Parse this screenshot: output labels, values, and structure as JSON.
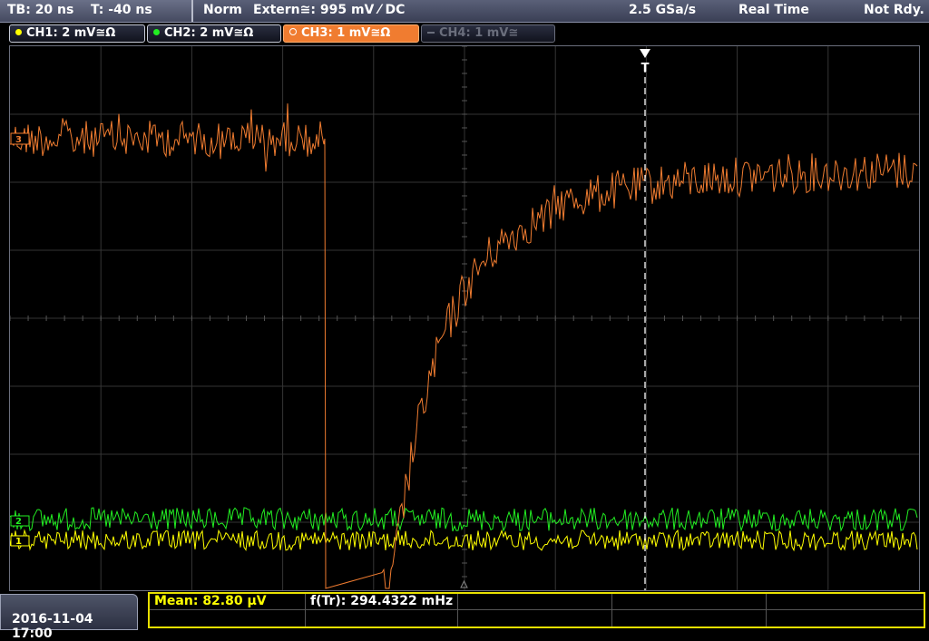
{
  "status_bar": {
    "timebase": "TB: 20 ns",
    "trigger_time": "T: -40 ns",
    "trigger_mode": "Norm",
    "trigger_source": "Extern≅: 995 mV ⁄ DC",
    "sample_rate": "2.5 GSa/s",
    "acquisition_mode": "Real Time",
    "status": "Not Rdy."
  },
  "channels": [
    {
      "label": "CH1: 2 mV≅Ω",
      "color": "#ffff00",
      "state": "on"
    },
    {
      "label": "CH2: 2 mV≅Ω",
      "color": "#22ee22",
      "state": "on"
    },
    {
      "label": "CH3: 1 mV≅Ω",
      "color": "#f07c30",
      "state": "active"
    },
    {
      "label": "CH4: 1 mV≅",
      "color": "#6a6e7c",
      "state": "off"
    }
  ],
  "markers": {
    "trigger_marker": "T",
    "ch3_ref": "3",
    "ch2_ref": "2",
    "ch1_ref": "1"
  },
  "waveforms": {
    "ch3_colour": "#f07c30",
    "ch2_colour": "#22ee22",
    "ch1_colour": "#ffff00",
    "grid_colour": "#3a3a3a"
  },
  "bottom_bar": {
    "datetime": "2016-11-04 17:00",
    "measurements": [
      {
        "label": "Mean: 82.80 µV",
        "color": "#ffff00"
      },
      {
        "label": "f(Tr): 294.4322 mHz",
        "color": "#ffffff"
      }
    ]
  }
}
